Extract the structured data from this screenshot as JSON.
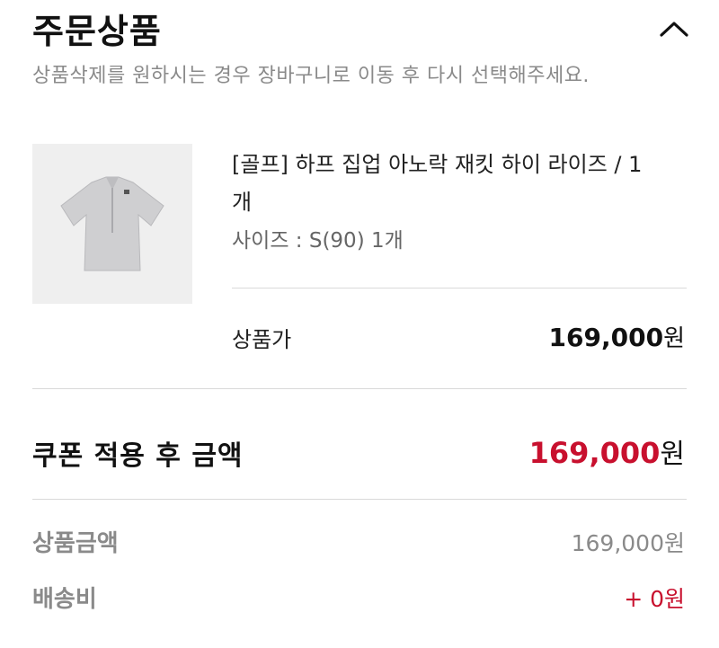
{
  "header": {
    "title": "주문상품",
    "collapse_icon": "chevron-up-icon"
  },
  "notice": "상품삭제를 원하시는 경우 장바구니로 이동 후 다시 선택해주세요.",
  "product": {
    "name_line1": "[골프] 하프 집업 아노락 재킷 하이 라이즈 / 1",
    "name_line2": "개",
    "option": "사이즈 : S(90) 1개",
    "price_label": "상품가",
    "price_value": "169,000",
    "currency": "원"
  },
  "coupon_total": {
    "label": "쿠폰 적용 후 금액",
    "value": "169,000",
    "currency": "원"
  },
  "summary": [
    {
      "label": "상품금액",
      "value": "169,000원"
    },
    {
      "label": "배송비",
      "value": "+ 0원"
    }
  ],
  "colors": {
    "accent": "#c8102e",
    "muted": "#8a8a8a",
    "divider": "#d9d9d9"
  }
}
